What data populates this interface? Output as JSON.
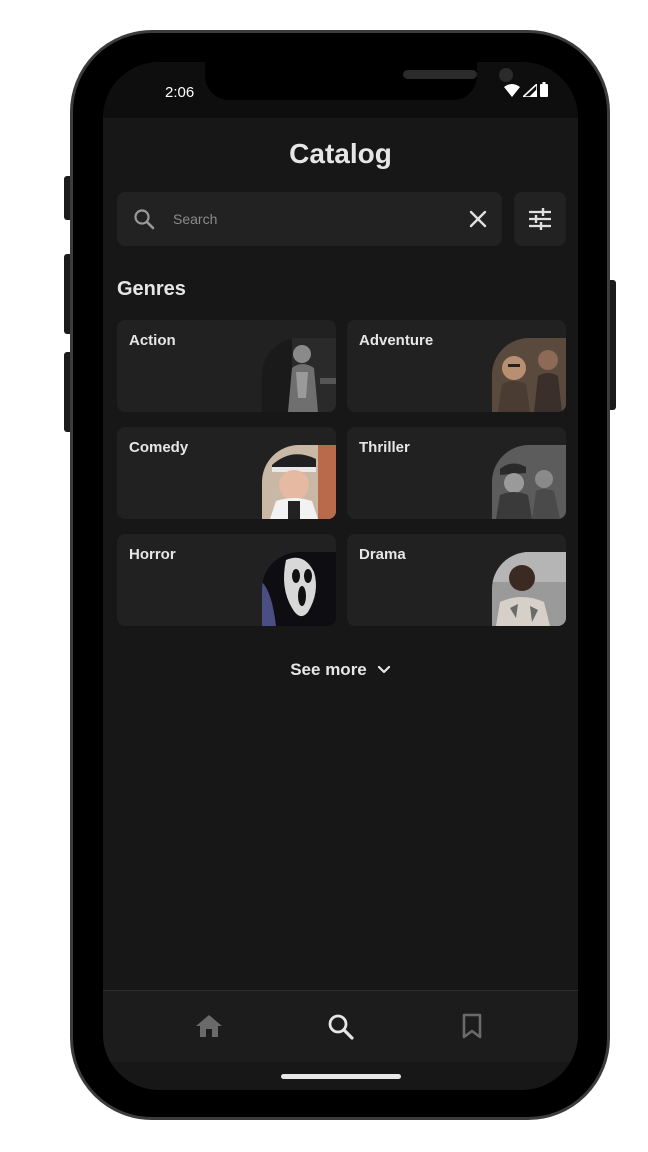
{
  "status": {
    "time": "2:06"
  },
  "header": {
    "title": "Catalog"
  },
  "search": {
    "placeholder": "Search",
    "value": ""
  },
  "genres": {
    "title": "Genres",
    "items": [
      {
        "label": "Action"
      },
      {
        "label": "Adventure"
      },
      {
        "label": "Comedy"
      },
      {
        "label": "Thriller"
      },
      {
        "label": "Horror"
      },
      {
        "label": "Drama"
      }
    ],
    "see_more": "See more"
  },
  "nav": {
    "items": [
      "home-icon",
      "search-icon",
      "bookmark-icon"
    ],
    "active": "search-icon"
  },
  "colors": {
    "background": "#171717",
    "card": "#212121",
    "text": "#e6e6e6"
  }
}
